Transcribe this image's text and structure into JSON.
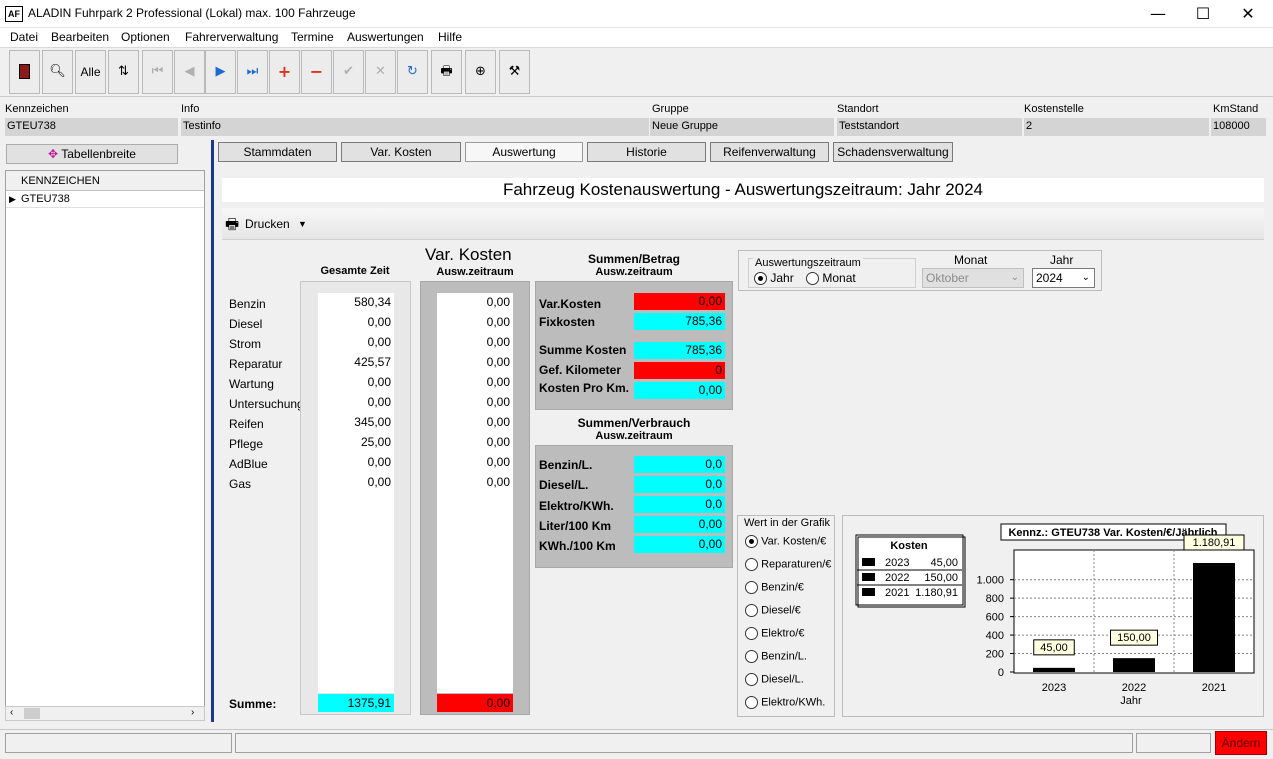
{
  "window": {
    "app_icon_text": "AF",
    "title": "ALADIN Fuhrpark 2 Professional (Lokal)  max. 100 Fahrzeuge",
    "minimize": "—",
    "maximize": "☐",
    "close": "✕"
  },
  "menu": [
    "Datei",
    "Bearbeiten",
    "Optionen",
    "Fahrerverwaltung",
    "Termine",
    "Auswertungen",
    "Hilfe"
  ],
  "toolbar": {
    "alle_label": "Alle"
  },
  "header": {
    "kennzeichen_label": "Kennzeichen",
    "kennzeichen_value": "GTEU738",
    "info_label": "Info",
    "info_value": "Testinfo",
    "gruppe_label": "Gruppe",
    "gruppe_value": "Neue Gruppe",
    "standort_label": "Standort",
    "standort_value": "Teststandort",
    "kostenstelle_label": "Kostenstelle",
    "kostenstelle_value": "2",
    "kmstand_label": "KmStand",
    "kmstand_value": "108000"
  },
  "left": {
    "tabellenbreite": "Tabellenbreite",
    "column_header": "KENNZEICHEN",
    "rows": [
      "GTEU738"
    ]
  },
  "tabs": [
    "Stammdaten",
    "Var. Kosten",
    "Auswertung",
    "Historie",
    "Reifenverwaltung",
    "Schadensverwaltung"
  ],
  "report": {
    "title": "Fahrzeug Kostenauswertung - Auswertungszeitraum: Jahr 2024",
    "print_label": "Drucken",
    "categories": [
      "Benzin",
      "Diesel",
      "Strom",
      "Reparatur",
      "Wartung",
      "Untersuchung",
      "Reifen",
      "Pflege",
      "AdBlue",
      "Gas"
    ],
    "gesamt_header": "Gesamte Zeit",
    "gesamt_values": [
      "580,34",
      "0,00",
      "0,00",
      "425,57",
      "0,00",
      "0,00",
      "345,00",
      "25,00",
      "0,00",
      "0,00"
    ],
    "var_title": "Var. Kosten",
    "var_header": "Ausw.zeitraum",
    "var_values": [
      "0,00",
      "0,00",
      "0,00",
      "0,00",
      "0,00",
      "0,00",
      "0,00",
      "0,00",
      "0,00",
      "0,00"
    ],
    "summe_label": "Summe:",
    "summe_gesamt": "1375,91",
    "summe_var": "0,00"
  },
  "summen_betrag": {
    "title": "Summen/Betrag",
    "subtitle": "Ausw.zeitraum",
    "var_kosten_label": "Var.Kosten",
    "var_kosten": "0,00",
    "fixkosten_label": "Fixkosten",
    "fixkosten": "785,36",
    "summe_kosten_label": "Summe Kosten",
    "summe_kosten": "785,36",
    "gef_km_label": "Gef. Kilometer",
    "gef_km": "0",
    "kosten_pro_km_label": "Kosten Pro Km.",
    "kosten_pro_km": "0,00"
  },
  "summen_verbrauch": {
    "title": "Summen/Verbrauch",
    "subtitle": "Ausw.zeitraum",
    "rows": [
      {
        "label": "Benzin/L.",
        "value": "0,0"
      },
      {
        "label": "Diesel/L.",
        "value": "0,0"
      },
      {
        "label": "Elektro/KWh.",
        "value": "0,0"
      },
      {
        "label": "Liter/100 Km",
        "value": "0,00"
      },
      {
        "label": "KWh./100 Km",
        "value": "0,00"
      }
    ]
  },
  "zeitraum": {
    "group_label": "Auswertungszeitraum",
    "jahr_radio": "Jahr",
    "monat_radio": "Monat",
    "monat_label": "Monat",
    "monat_value": "Oktober",
    "jahr_label": "Jahr",
    "jahr_value": "2024"
  },
  "wert_grafik": {
    "label": "Wert in der Grafik",
    "options": [
      "Var. Kosten/€",
      "Reparaturen/€",
      "Benzin/€",
      "Diesel/€",
      "Elektro/€",
      "Benzin/L.",
      "Diesel/L.",
      "Elektro/KWh."
    ],
    "selected": 0
  },
  "chart_data": {
    "type": "bar",
    "title": "Kennz.: GTEU738  Var. Kosten/€/Jährlich",
    "categories": [
      "2023",
      "2022",
      "2021"
    ],
    "values": [
      45.0,
      150.0,
      1180.91
    ],
    "data_labels": [
      "45,00",
      "150,00",
      "1.180,91"
    ],
    "y_ticks": [
      "0",
      "200",
      "400",
      "600",
      "800",
      "1.000"
    ],
    "ylim": [
      0,
      1300
    ],
    "xlabel": "Jahr",
    "legend_title": "Kosten",
    "legend_values": [
      "45,00",
      "150,00",
      "1.180,91"
    ],
    "bar_color": "#000000",
    "grid": true
  },
  "status": {
    "aendern": "Ändern"
  }
}
